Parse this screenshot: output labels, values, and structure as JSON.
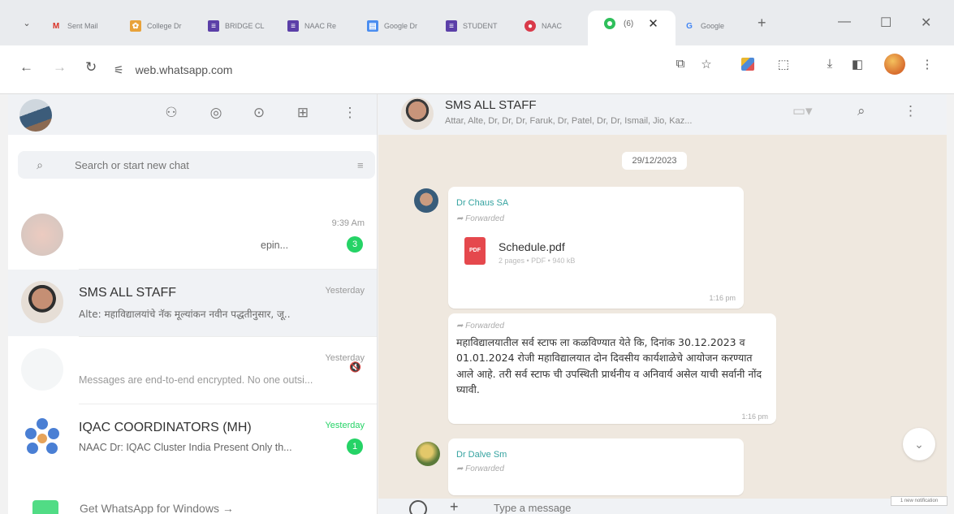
{
  "browser": {
    "tabs": [
      {
        "label": "Sent Mail",
        "icon": "gmail-icon",
        "color": "#d93025"
      },
      {
        "label": "College Dr",
        "icon": "puzzle-icon",
        "color": "#e8a23a"
      },
      {
        "label": "BRIDGE CL",
        "icon": "forms-icon",
        "color": "#5b3fa8"
      },
      {
        "label": "NAAC Re",
        "icon": "forms-icon",
        "color": "#5b3fa8"
      },
      {
        "label": "Google Dr",
        "icon": "doc-icon",
        "color": "#4a8df0"
      },
      {
        "label": "STUDENT",
        "icon": "forms-icon",
        "color": "#5b3fa8"
      },
      {
        "label": "NAAC",
        "icon": "circle-icon",
        "color": "#d93a4a"
      },
      {
        "label": "Google",
        "icon": "google-icon",
        "color": "#4285f4"
      }
    ],
    "active_tab": {
      "label": "(6)"
    },
    "url": "web.whatsapp.com"
  },
  "sidebar": {
    "search_placeholder": "Search or start new chat",
    "chats": [
      {
        "name": "",
        "time": "9:39 Am",
        "preview": "epin...",
        "badge": "3",
        "faded": true
      },
      {
        "name": "SMS ALL STAFF",
        "time": "Yesterday",
        "preview": "Alte: महाविद्यालयांचे नॅक मूल्यांकन नवीन पद्धतीनुसार, जू..",
        "badge": "",
        "selected": true
      },
      {
        "name": "",
        "time": "Yesterday",
        "preview": "Messages are end-to-end encrypted. No one outsi...",
        "badge": "",
        "faded": true
      },
      {
        "name": "IQAC COORDINATORS (MH)",
        "time": "Yesterday",
        "preview": "NAAC Dr: IQAC Cluster India Present Only th...",
        "badge": "1"
      }
    ],
    "get_app": "Get WhatsApp for Windows →"
  },
  "conversation": {
    "title": "SMS ALL STAFF",
    "members": "Attar, Alte, Dr, Dr, Dr, Faruk, Dr, Patel, Dr, Dr, Ismail, Jio, Kaz...",
    "date_pill": "29/12/2023",
    "messages": [
      {
        "sender": "Dr Chaus SA",
        "forwarded": "Forwarded",
        "doc_name": "Schedule.pdf",
        "doc_meta": "2 pages • PDF • 940 kB",
        "time": "1:16 pm"
      },
      {
        "forwarded": "Forwarded",
        "text": "महाविद्यालयातील सर्व स्टाफ ला कळविण्यात येते कि, दिनांक 30.12.2023 व 01.01.2024 रोजी महाविद्यालयात दोन दिवसीय कार्यशाळेचे आयोजन करण्यात आले आहे. तरी सर्व स्टाफ ची उपस्थिती प्रार्थनीय व अनिवार्य असेल याची सर्वानी नोंद घ्यावी.",
        "time": "1:16 pm"
      },
      {
        "sender": "Dr Dalve Sm",
        "forwarded": "Forwarded"
      }
    ],
    "composer_placeholder": "Type a message"
  },
  "colors": {
    "accent": "#25d366",
    "sender": "#35a3a0",
    "pdf": "#e5484d"
  }
}
